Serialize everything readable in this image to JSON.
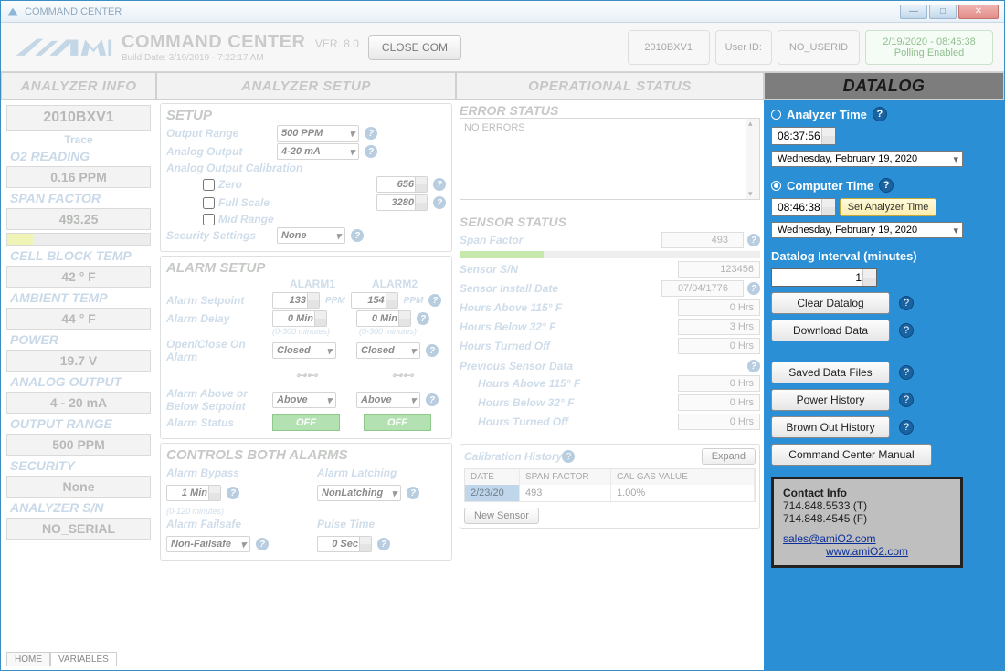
{
  "titlebar": {
    "text": "COMMAND CENTER"
  },
  "topbar": {
    "app_title": "COMMAND CENTER",
    "version": "VER. 8.0",
    "build_date": "Build Date:  3/19/2019 - 7:22:17 AM",
    "closecom": "CLOSE COM",
    "analyzer_name": "2010BXV1",
    "user_id_label": "User ID:",
    "user_id": "NO_USERID",
    "poll_ts": "2/19/2020 - 08:46:38",
    "poll_status": "Polling Enabled"
  },
  "col_headers": {
    "analyzer_info": "ANALYZER INFO",
    "analyzer_setup": "ANALYZER SETUP",
    "op_status": "OPERATIONAL STATUS",
    "datalog": "DATALOG"
  },
  "info": {
    "model": "2010BXV1",
    "mode": "Trace",
    "o2_label": "O2 READING",
    "o2_val": "0.16 PPM",
    "span_label": "SPAN FACTOR",
    "span_val": "493.25",
    "cbt_label": "CELL BLOCK TEMP",
    "cbt_val": "42  °  F",
    "amb_label": "AMBIENT TEMP",
    "amb_val": "44  °  F",
    "pwr_label": "POWER",
    "pwr_val": "19.7 V",
    "ao_label": "ANALOG OUTPUT",
    "ao_val": "4 - 20 mA",
    "or_label": "OUTPUT RANGE",
    "or_val": "500 PPM",
    "sec_label": "SECURITY",
    "sec_val": "None",
    "sn_label": "ANALYZER S/N",
    "sn_val": "NO_SERIAL"
  },
  "setup_group": {
    "title": "SETUP",
    "output_range_lbl": "Output Range",
    "output_range_val": "500 PPM",
    "analog_output_lbl": "Analog Output",
    "analog_output_val": "4-20 mA",
    "aoc_lbl": "Analog Output Calibration",
    "zero_lbl": "Zero",
    "zero_val": "656",
    "fs_lbl": "Full Scale",
    "fs_val": "3280",
    "mr_lbl": "Mid Range",
    "security_lbl": "Security Settings",
    "security_val": "None"
  },
  "alarm_group": {
    "title": "ALARM SETUP",
    "h1": "ALARM1",
    "h2": "ALARM2",
    "setpoint_lbl": "Alarm Setpoint",
    "sp1": "133",
    "sp2": "154",
    "sp_unit": "PPM",
    "delay_lbl": "Alarm Delay",
    "d1": "0 Min",
    "d2": "0 Min",
    "delay_range": "(0-300 minutes)",
    "oc_lbl": "Open/Close On Alarm",
    "oc1": "Closed",
    "oc2": "Closed",
    "ab_lbl": "Alarm Above or Below Setpoint",
    "ab1": "Above",
    "ab2": "Above",
    "status_lbl": "Alarm Status",
    "s1": "OFF",
    "s2": "OFF"
  },
  "ctrl_group": {
    "title": "CONTROLS BOTH ALARMS",
    "bypass_lbl": "Alarm Bypass",
    "bypass_val": "1 Min",
    "bypass_range": "(0-120 minutes)",
    "latch_lbl": "Alarm Latching",
    "latch_val": "NonLatching",
    "failsafe_lbl": "Alarm Failsafe",
    "failsafe_val": "Non-Failsafe",
    "pulse_lbl": "Pulse Time",
    "pulse_val": "0 Sec"
  },
  "error": {
    "title": "ERROR STATUS",
    "text": "NO ERRORS"
  },
  "sensor": {
    "title": "SENSOR STATUS",
    "span_lbl": "Span Factor",
    "span_val": "493",
    "sn_lbl": "Sensor S/N",
    "sn_val": "123456",
    "inst_lbl": "Sensor Install Date",
    "inst_val": "07/04/1776",
    "ha_lbl": "Hours Above 115° F",
    "ha_val": "0 Hrs",
    "hb_lbl": "Hours Below 32° F",
    "hb_val": "3 Hrs",
    "ho_lbl": "Hours Turned Off",
    "ho_val": "0 Hrs",
    "prev_lbl": "Previous Sensor Data",
    "pha_lbl": "Hours Above 115° F",
    "pha_val": "0 Hrs",
    "phb_lbl": "Hours Below 32° F",
    "phb_val": "0 Hrs",
    "pho_lbl": "Hours Turned Off",
    "pho_val": "0 Hrs"
  },
  "calhist": {
    "title": "Calibration History",
    "expand": "Expand",
    "h_date": "DATE",
    "h_span": "SPAN FACTOR",
    "h_cal": "CAL GAS VALUE",
    "r_date": "2/23/20",
    "r_span": "493",
    "r_cal": "1.00%",
    "new_sensor": "New Sensor"
  },
  "datalog": {
    "analyzer_time_lbl": "Analyzer Time",
    "analyzer_time": "08:37:56",
    "analyzer_date": "Wednesday,   February   19, 2020",
    "computer_time_lbl": "Computer Time",
    "computer_time": "08:46:38",
    "set_btn": "Set Analyzer Time",
    "computer_date": "Wednesday,   February   19, 2020",
    "interval_lbl": "Datalog Interval (minutes)",
    "interval_val": "1",
    "clear": "Clear Datalog",
    "download": "Download Data",
    "saved": "Saved Data Files",
    "power_hist": "Power History",
    "brown": "Brown Out History",
    "manual": "Command Center Manual"
  },
  "contact": {
    "title": "Contact Info",
    "tel": "714.848.5533 (T)",
    "fax": "714.848.4545 (F)",
    "email": "sales@amiO2.com",
    "web": "www.amiO2.com"
  },
  "tabs": {
    "home": "HOME",
    "vars": "VARIABLES"
  }
}
